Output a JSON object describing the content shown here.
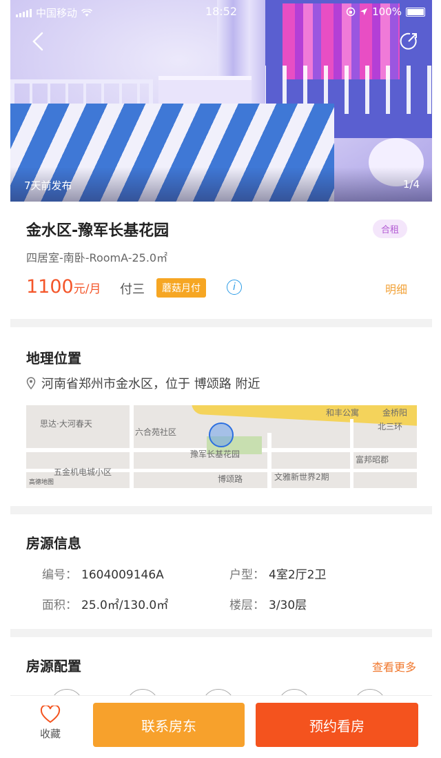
{
  "status_bar": {
    "carrier": "中国移动",
    "time": "18:52",
    "battery": "100%"
  },
  "gallery": {
    "posted": "7天前发布",
    "counter": "1/4"
  },
  "listing": {
    "title": "金水区-豫军长基花园",
    "rental_type": "合租",
    "subtitle": "四居室-南卧-RoomA-25.0㎡",
    "price_number": "1100",
    "price_unit": "元/月",
    "pay_term": "付三",
    "pay_badge": "蘑菇月付",
    "detail_link": "明细"
  },
  "location": {
    "heading": "地理位置",
    "address": "河南省郑州市金水区，位于 博颂路 附近",
    "map": {
      "labels": {
        "a": "思达·大河春天",
        "b": "六合苑社区",
        "c": "豫军长基花园",
        "d": "五金机电城小区",
        "e": "博颂路",
        "f": "文雅新世界2期",
        "g": "富邦昭郡",
        "h": "北三环",
        "i": "和丰公寓",
        "j": "金桥阳",
        "logo": "高德地图"
      }
    }
  },
  "house_info": {
    "heading": "房源信息",
    "id_label": "编号：",
    "id_value": "1604009146A",
    "layout_label": "户型：",
    "layout_value": "4室2厅2卫",
    "area_label": "面积：",
    "area_value": "25.0㎡/130.0㎡",
    "floor_label": "楼层：",
    "floor_value": "3/30层"
  },
  "facilities": {
    "heading": "房源配置",
    "more": "查看更多"
  },
  "bottom_bar": {
    "favorite": "收藏",
    "contact": "联系房东",
    "book": "预约看房"
  },
  "colors": {
    "accent_orange": "#f4531e",
    "accent_yellow": "#f7a12c",
    "price": "#f4562a"
  }
}
